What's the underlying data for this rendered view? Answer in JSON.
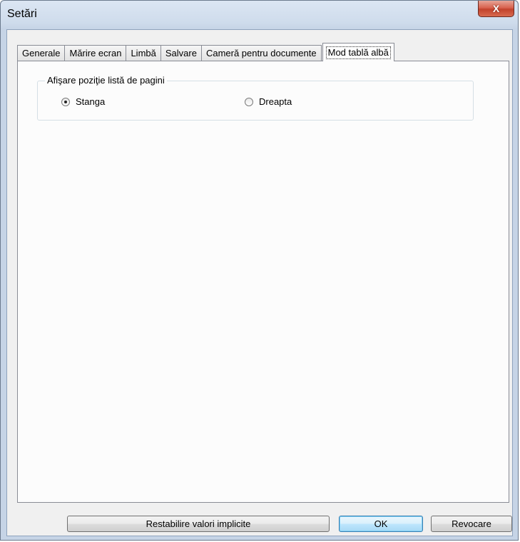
{
  "window": {
    "title": "Setări",
    "close_label": "X"
  },
  "tabs": [
    {
      "label": "Generale"
    },
    {
      "label": "Mărire ecran"
    },
    {
      "label": "Limbă"
    },
    {
      "label": "Salvare"
    },
    {
      "label": "Cameră pentru documente"
    },
    {
      "label": "Mod tablă albă",
      "active": true
    }
  ],
  "group": {
    "label": "Afişare poziţie listă de pagini",
    "options": [
      {
        "label": "Stanga",
        "selected": true
      },
      {
        "label": "Dreapta",
        "selected": false
      }
    ]
  },
  "buttons": {
    "restore": "Restabilire valori implicite",
    "ok": "OK",
    "cancel": "Revocare"
  }
}
